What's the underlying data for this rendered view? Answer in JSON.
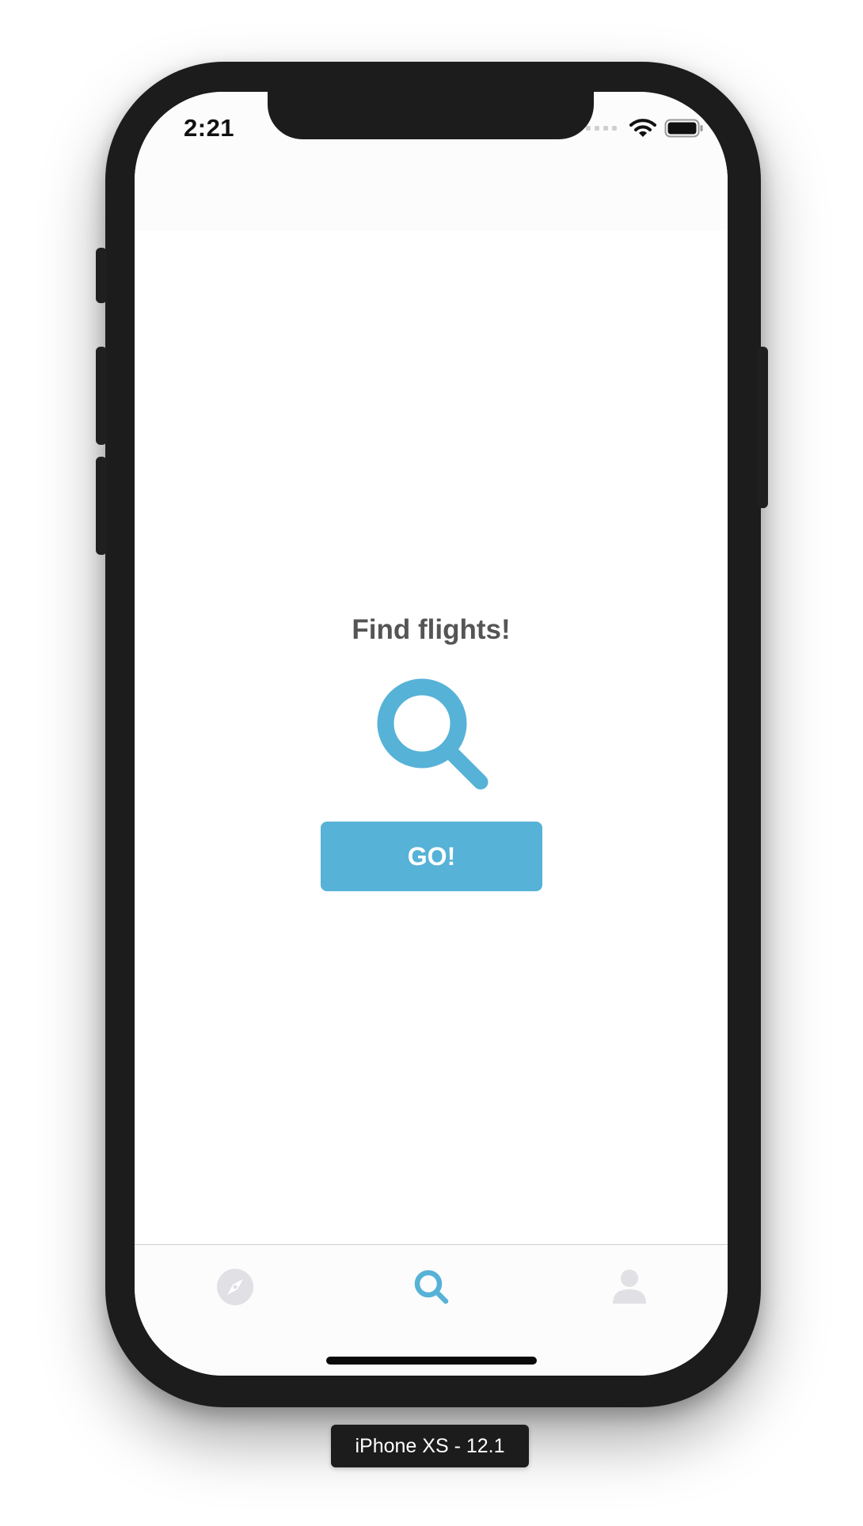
{
  "status_bar": {
    "time": "2:21",
    "icons": [
      "signal-dots-icon",
      "wifi-icon",
      "battery-icon"
    ]
  },
  "main": {
    "title": "Find flights!",
    "hero_icon": "search-icon",
    "go_label": "GO!"
  },
  "tab_bar": {
    "items": [
      {
        "icon": "compass-icon",
        "active": false
      },
      {
        "icon": "search-icon",
        "active": true
      },
      {
        "icon": "profile-icon",
        "active": false
      }
    ]
  },
  "simulator_label": "iPhone XS - 12.1",
  "colors": {
    "accent": "#56b2d7",
    "inactive_icon": "#e0e0e5",
    "title_text": "#555555",
    "device_frame": "#1c1c1c"
  }
}
